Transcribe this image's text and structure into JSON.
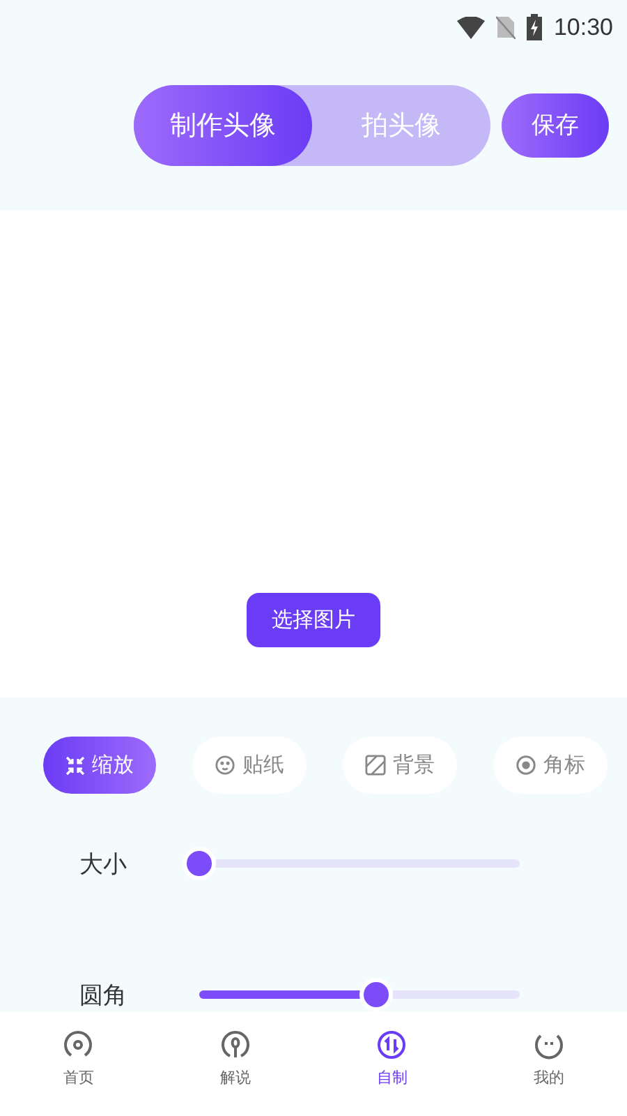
{
  "status_bar": {
    "time": "10:30"
  },
  "header": {
    "tabs": [
      {
        "label": "制作头像",
        "selected": true
      },
      {
        "label": "拍头像",
        "selected": false
      }
    ],
    "save_button": "保存"
  },
  "canvas": {
    "select_button": "选择图片"
  },
  "tools": [
    {
      "kind": "zoom",
      "label": "缩放",
      "selected": true
    },
    {
      "kind": "sticker",
      "label": "贴纸",
      "selected": false
    },
    {
      "kind": "background",
      "label": "背景",
      "selected": false
    },
    {
      "kind": "badge",
      "label": "角标",
      "selected": false
    }
  ],
  "sliders": [
    {
      "label": "大小",
      "level": 0
    },
    {
      "label": "圆角",
      "level": 0.55
    }
  ],
  "bottom_nav": [
    {
      "kind": "home",
      "label": "首页",
      "selected": false
    },
    {
      "kind": "explain",
      "label": "解说",
      "selected": false
    },
    {
      "kind": "custom",
      "label": "自制",
      "selected": true
    },
    {
      "kind": "mine",
      "label": "我的",
      "selected": false
    }
  ]
}
